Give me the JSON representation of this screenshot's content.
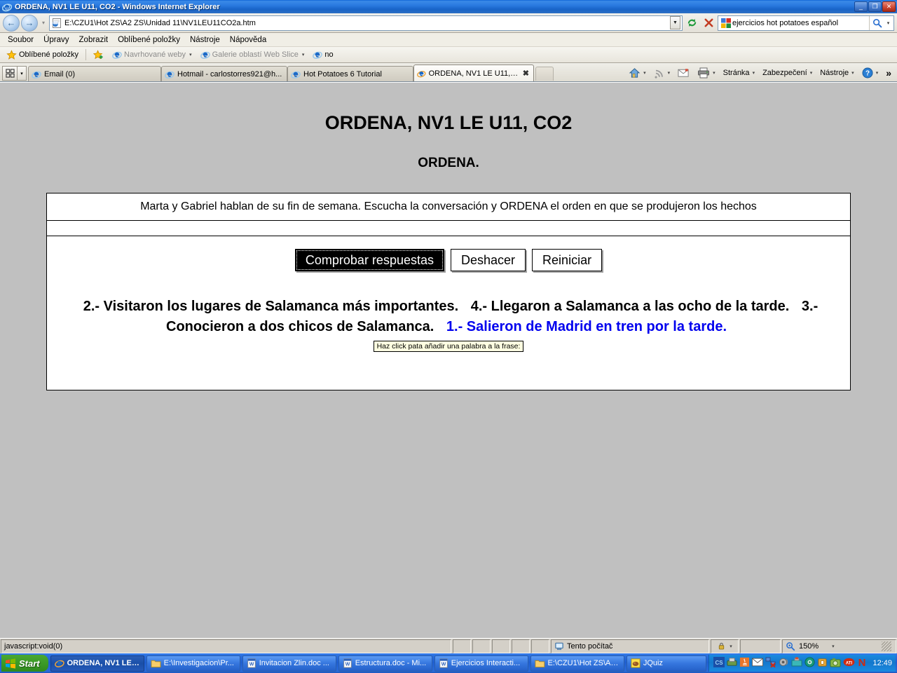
{
  "window": {
    "title": "ORDENA, NV1 LE U11, CO2 - Windows Internet Explorer",
    "minimize": "_",
    "restore": "❐",
    "close": "✕"
  },
  "address_bar": {
    "url": "E:\\CZU1\\Hot ZS\\A2 ZS\\Unidad 11\\NV1LEU11CO2a.htm",
    "back_icon": "back-arrow-icon",
    "forward_icon": "forward-arrow-icon",
    "history_caret": "▾",
    "refresh_icon": "refresh-icon",
    "stop_icon": "stop-icon",
    "search_query": "ejercicios hot potatoes español",
    "search_provider_icon": "google-icon",
    "search_go_icon": "search-icon",
    "search_caret": "▾"
  },
  "menubar": {
    "items": [
      {
        "label": "Soubor"
      },
      {
        "label": "Úpravy"
      },
      {
        "label": "Zobrazit"
      },
      {
        "label": "Oblíbené položky"
      },
      {
        "label": "Nástroje"
      },
      {
        "label": "Nápověda"
      }
    ]
  },
  "favorites_bar": {
    "favorites_label": "Oblíbené položky",
    "items": [
      {
        "label": "Navrhované weby",
        "icon": "ie-icon",
        "caret": "▾",
        "dim": true
      },
      {
        "label": "Galerie oblastí Web Slice",
        "icon": "ie-icon",
        "caret": "▾",
        "dim": true
      },
      {
        "label": "no",
        "icon": "ie-icon",
        "caret": "",
        "dim": false
      }
    ]
  },
  "tabs": {
    "quick_tabs_icon": "quick-tabs-icon",
    "tab_list_caret": "▾",
    "items": [
      {
        "label": "Email (0)",
        "active": false
      },
      {
        "label": "Hotmail - carlostorres921@h...",
        "active": false
      },
      {
        "label": "Hot Potatoes 6 Tutorial",
        "active": false
      },
      {
        "label": "ORDENA, NV1 LE U11, CO2",
        "active": true
      }
    ],
    "close_glyph": "✖"
  },
  "command_bar": {
    "home_icon": "home-icon",
    "feeds_icon": "rss-icon",
    "mail_icon": "mail-icon",
    "print_icon": "printer-icon",
    "caret": "▾",
    "items": [
      {
        "label": "Stránka"
      },
      {
        "label": "Zabezpečení"
      },
      {
        "label": "Nástroje"
      }
    ],
    "help_icon": "help-icon",
    "overflow": "»"
  },
  "page": {
    "title": "ORDENA, NV1 LE U11, CO2",
    "subtitle": "ORDENA.",
    "instructions": "Marta y Gabriel hablan de su fin de semana. Escucha la conversación y ORDENA el orden en que se produjeron los hechos",
    "feedback": "",
    "buttons": [
      {
        "label": "Comprobar respuestas",
        "focused": true
      },
      {
        "label": "Deshacer",
        "focused": false
      },
      {
        "label": "Reiniciar",
        "focused": false
      }
    ],
    "segments": [
      {
        "text": "2.- Visitaron los lugares de Salamanca más importantes.",
        "color": "black"
      },
      {
        "text": "4.- Llegaron a Salamanca a las ocho de la tarde.",
        "color": "black"
      },
      {
        "text": "3.- Conocieron a dos chicos de Salamanca.",
        "color": "black"
      },
      {
        "text": "1.- Salieron de Madrid en tren por la tarde.",
        "color": "blue"
      }
    ],
    "tooltip": "Haz click pata añadir una palabra a la frase:",
    "blue_color": "#0000ee"
  },
  "status_bar": {
    "status_text": "javascript:void(0)",
    "zone_icon": "computer-icon",
    "zone_label": "Tento počítač",
    "protected_icon": "lock-icon",
    "caret": "▾",
    "zoom_icon": "zoom-icon",
    "zoom_level": "150%"
  },
  "taskbar": {
    "start_label": "Start",
    "items": [
      {
        "label": "ORDENA, NV1 LE ...",
        "icon": "ie-icon",
        "active": true
      },
      {
        "label": "E:\\Investigacion\\Pr...",
        "icon": "folder-icon",
        "active": false
      },
      {
        "label": "Invitacion Zlin.doc ...",
        "icon": "word-icon",
        "active": false
      },
      {
        "label": "Estructura.doc - Mi...",
        "icon": "word-icon",
        "active": false
      },
      {
        "label": "Ejercicios Interacti...",
        "icon": "word-icon",
        "active": false
      },
      {
        "label": "E:\\CZU1\\Hot ZS\\A2...",
        "icon": "folder-icon",
        "active": false
      },
      {
        "label": "JQuiz",
        "icon": "jquiz-icon",
        "active": false
      }
    ],
    "tray_icons": [
      "cs-icon",
      "scanner-icon",
      "java-icon",
      "mail-icon",
      "network-disconnected-icon",
      "volume-icon",
      "toolbox-icon",
      "green-disc-icon",
      "security-icon",
      "camera-icon",
      "ati-icon",
      "norton-icon"
    ],
    "clock": "12:49"
  }
}
